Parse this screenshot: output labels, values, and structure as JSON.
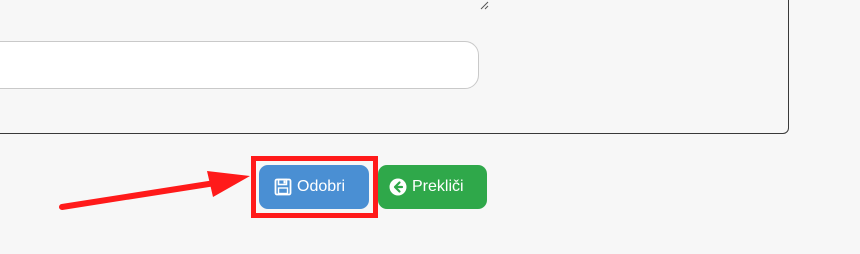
{
  "form": {
    "notes_value": "",
    "text_value": ""
  },
  "buttons": {
    "approve": {
      "label": "Odobri",
      "icon": "floppy-disk-icon",
      "color": "#4a8fd3"
    },
    "cancel": {
      "label": "Prekliči",
      "icon": "arrow-circle-left-icon",
      "color": "#2fa84a"
    }
  },
  "annotation": {
    "highlight_color": "#ff1a1a",
    "arrow_color": "#ff1a1a"
  }
}
